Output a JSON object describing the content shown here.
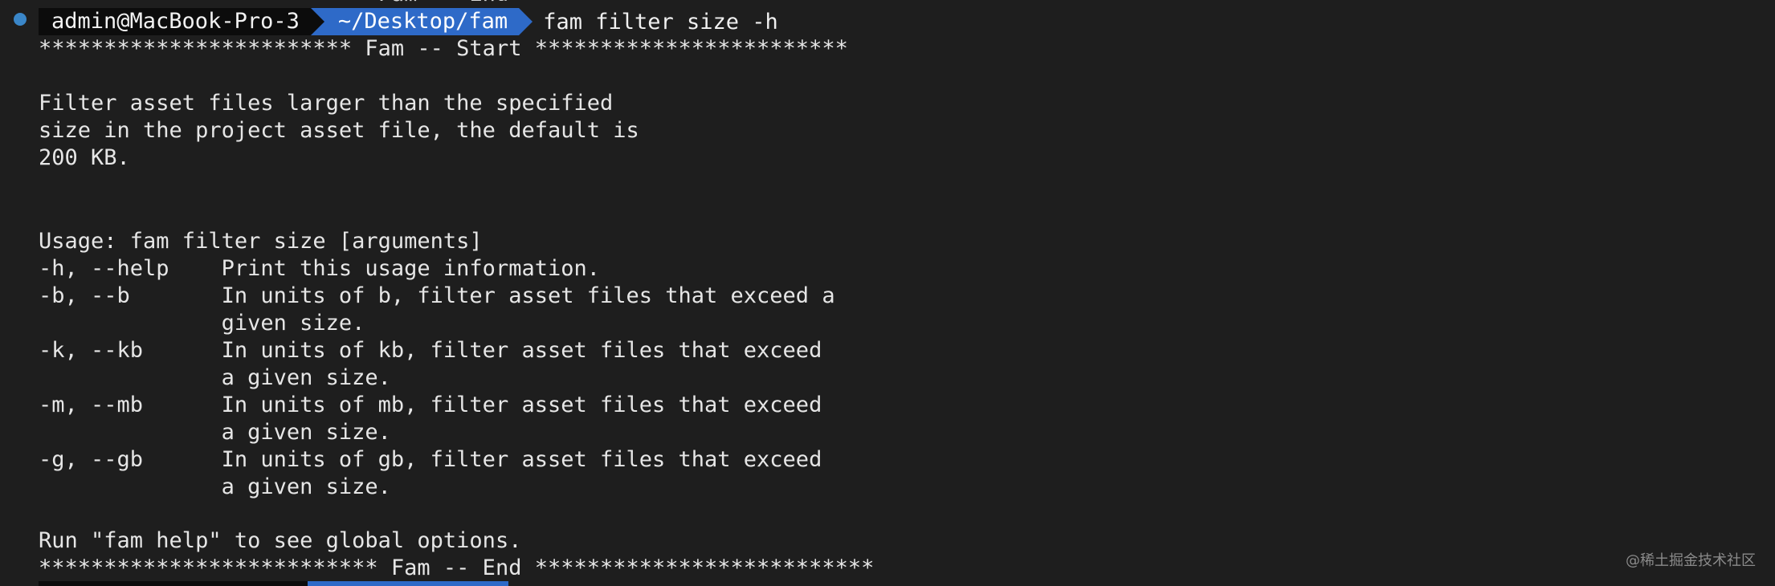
{
  "prompt": {
    "user": "admin@MacBook-Pro-3",
    "directory": "~/Desktop/fam",
    "command": "fam filter size -h"
  },
  "partial_top_line": "************************* Fam -- End *************************",
  "output": {
    "start_banner": "************************ Fam -- Start ************************",
    "description": [
      "Filter asset files larger than the specified",
      "size in the project asset file, the default is",
      "200 KB."
    ],
    "usage": "Usage: fam filter size [arguments]",
    "options": [
      "-h, --help    Print this usage information.",
      "-b, --b       In units of b, filter asset files that exceed a",
      "              given size.",
      "-k, --kb      In units of kb, filter asset files that exceed",
      "              a given size.",
      "-m, --mb      In units of mb, filter asset files that exceed",
      "              a given size.",
      "-g, --gb      In units of gb, filter asset files that exceed",
      "              a given size."
    ],
    "help_hint": "Run \"fam help\" to see global options.",
    "end_banner": "************************** Fam -- End **************************"
  },
  "watermark": "@稀土掘金技术社区",
  "colors": {
    "background": "#1e1e1e",
    "text": "#e6e6e6",
    "prompt_user_bg": "#0c0c0c",
    "prompt_dir_bg": "#2e6ac8",
    "status_dot": "#3a86c8"
  }
}
